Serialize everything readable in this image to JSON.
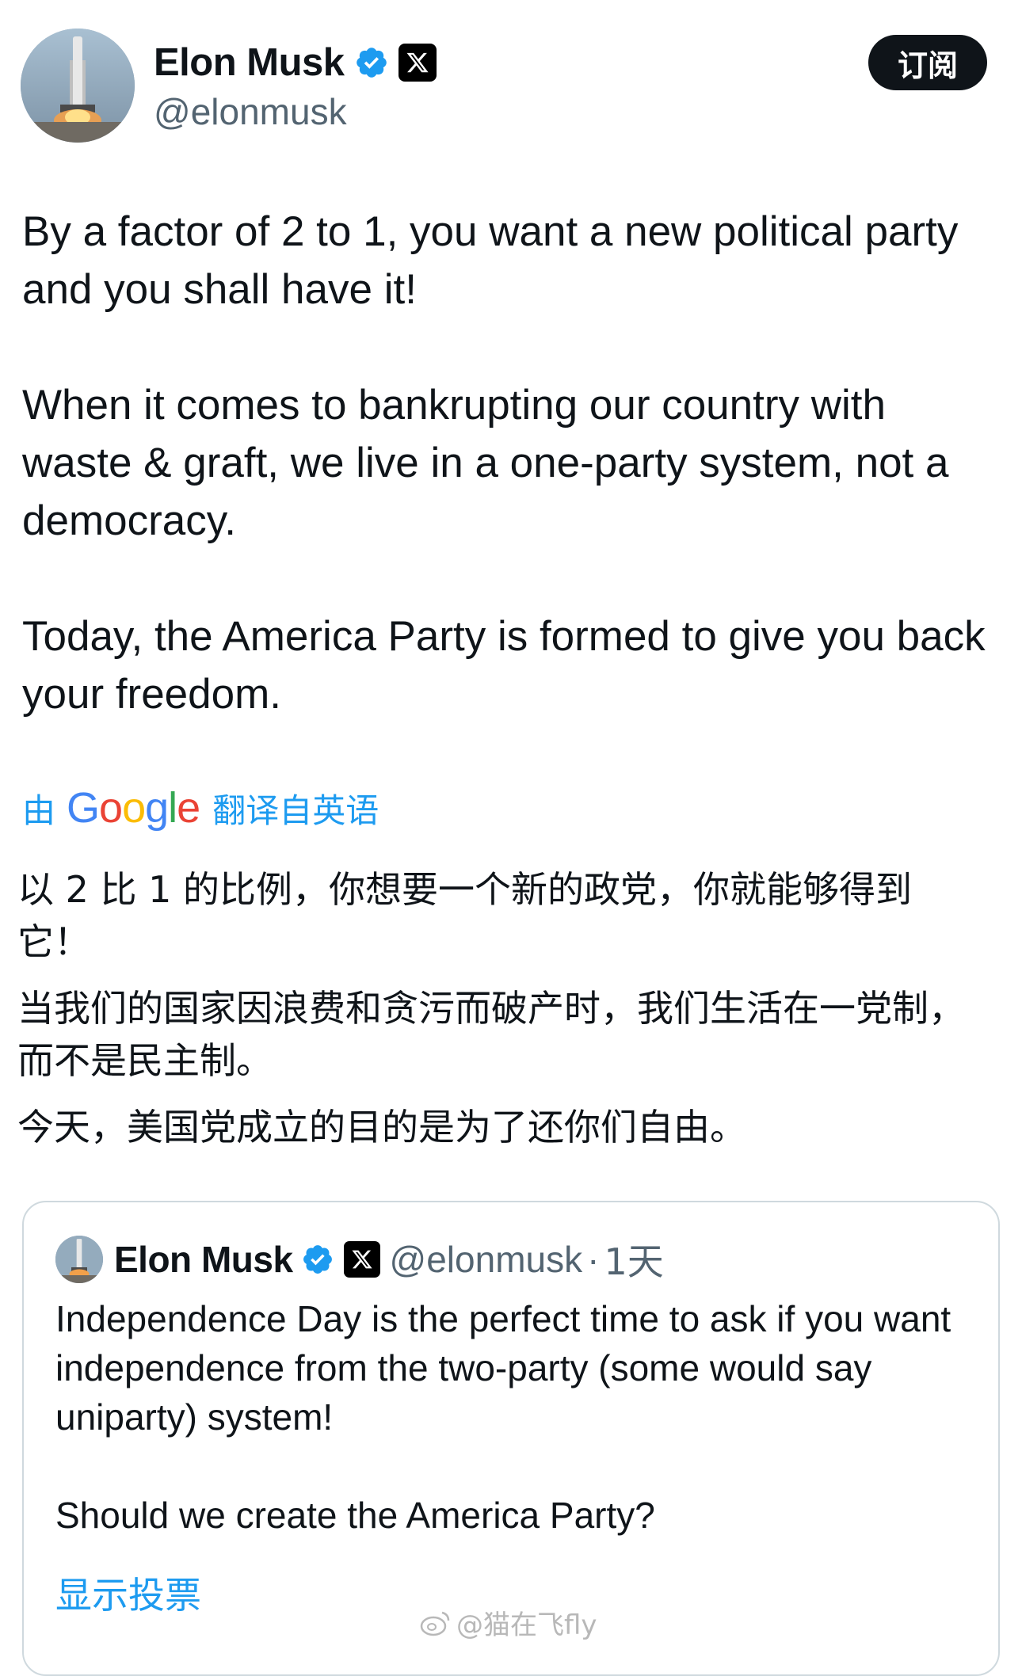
{
  "author": {
    "display_name": "Elon Musk",
    "handle": "@elonmusk",
    "avatar_icon": "rocket-launch-avatar",
    "verified_icon": "verified-badge-icon",
    "affiliation_icon": "x-logo-icon"
  },
  "subscribe_button": {
    "label": "订阅"
  },
  "tweet": {
    "paragraphs": [
      "By a factor of 2 to 1, you want a new political party and you shall have it!",
      "When it comes to bankrupting our country with waste & graft, we live in a one-party system, not a democracy.",
      "Today, the America Party is formed to give you back your freedom."
    ]
  },
  "translation": {
    "prefix": "由",
    "provider": "Google",
    "suffix": "翻译自英语",
    "paragraphs": [
      "以 2 比 1 的比例，你想要一个新的政党，你就能够得到它！",
      "当我们的国家因浪费和贪污而破产时，我们生活在一党制，而不是民主制。",
      "今天，美国党成立的目的是为了还你们自由。"
    ]
  },
  "quoted_tweet": {
    "display_name": "Elon Musk",
    "handle": "@elonmusk",
    "separator": "·",
    "time": "1天",
    "paragraphs": [
      "Independence Day is the perfect time to ask if you want independence from the two-party (some would say uniparty) system!",
      "Should we create the America Party?"
    ],
    "show_poll_label": "显示投票"
  },
  "watermark": {
    "text": "@猫在飞fly"
  },
  "colors": {
    "accent_blue": "#1d9bf0",
    "text_primary": "#0f1419",
    "text_secondary": "#536471",
    "button_dark": "#0f1419",
    "border": "#cfd9de"
  }
}
